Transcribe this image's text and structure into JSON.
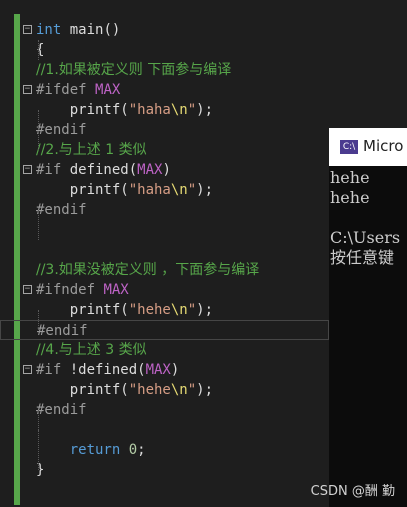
{
  "editor": {
    "lines": [
      {
        "fold": "−",
        "parts": [
          {
            "c": "kw",
            "t": "int"
          },
          {
            "c": "fn",
            "t": " main()"
          }
        ]
      },
      {
        "fold": "",
        "parts": [
          {
            "c": "fn",
            "t": "{"
          }
        ]
      },
      {
        "fold": "",
        "parts": [
          {
            "c": "cmt",
            "t": "//1.如果被定义则 下面参与编译"
          }
        ]
      },
      {
        "fold": "−",
        "parts": [
          {
            "c": "pp",
            "t": "#ifdef "
          },
          {
            "c": "mac",
            "t": "MAX"
          }
        ]
      },
      {
        "fold": "",
        "parts": [
          {
            "c": "fn",
            "t": "    printf("
          },
          {
            "c": "str",
            "t": "\"haha"
          },
          {
            "c": "esc",
            "t": "\\n"
          },
          {
            "c": "str",
            "t": "\""
          },
          {
            "c": "fn",
            "t": ");"
          }
        ]
      },
      {
        "fold": "",
        "parts": [
          {
            "c": "pp",
            "t": "#endif"
          }
        ]
      },
      {
        "fold": "",
        "parts": [
          {
            "c": "cmt",
            "t": "//2.与上述 1 类似"
          }
        ]
      },
      {
        "fold": "−",
        "parts": [
          {
            "c": "pp",
            "t": "#if "
          },
          {
            "c": "fn",
            "t": "defined("
          },
          {
            "c": "mac",
            "t": "MAX"
          },
          {
            "c": "fn",
            "t": ")"
          }
        ]
      },
      {
        "fold": "",
        "parts": [
          {
            "c": "fn",
            "t": "    printf("
          },
          {
            "c": "str",
            "t": "\"haha"
          },
          {
            "c": "esc",
            "t": "\\n"
          },
          {
            "c": "str",
            "t": "\""
          },
          {
            "c": "fn",
            "t": ");"
          }
        ]
      },
      {
        "fold": "",
        "parts": [
          {
            "c": "pp",
            "t": "#endif"
          }
        ]
      },
      {
        "fold": "",
        "parts": []
      },
      {
        "fold": "",
        "parts": []
      },
      {
        "fold": "",
        "parts": [
          {
            "c": "cmt",
            "t": "//3.如果没被定义则 ，下面参与编译"
          }
        ]
      },
      {
        "fold": "−",
        "parts": [
          {
            "c": "pp",
            "t": "#ifndef "
          },
          {
            "c": "mac",
            "t": "MAX"
          }
        ]
      },
      {
        "fold": "",
        "parts": [
          {
            "c": "fn",
            "t": "    printf("
          },
          {
            "c": "str",
            "t": "\"hehe"
          },
          {
            "c": "esc",
            "t": "\\n"
          },
          {
            "c": "str",
            "t": "\""
          },
          {
            "c": "fn",
            "t": ");"
          }
        ]
      },
      {
        "fold": "",
        "highlight": true,
        "parts": [
          {
            "c": "pp",
            "t": "#endif"
          }
        ]
      },
      {
        "fold": "",
        "parts": [
          {
            "c": "cmt",
            "t": "//4.与上述 3 类似"
          }
        ]
      },
      {
        "fold": "−",
        "parts": [
          {
            "c": "pp",
            "t": "#if "
          },
          {
            "c": "fn",
            "t": "!defined("
          },
          {
            "c": "mac",
            "t": "MAX"
          },
          {
            "c": "fn",
            "t": ")"
          }
        ]
      },
      {
        "fold": "",
        "parts": [
          {
            "c": "fn",
            "t": "    printf("
          },
          {
            "c": "str",
            "t": "\"hehe"
          },
          {
            "c": "esc",
            "t": "\\n"
          },
          {
            "c": "str",
            "t": "\""
          },
          {
            "c": "fn",
            "t": ");"
          }
        ]
      },
      {
        "fold": "",
        "parts": [
          {
            "c": "pp",
            "t": "#endif"
          }
        ]
      },
      {
        "fold": "",
        "parts": []
      },
      {
        "fold": "",
        "parts": [
          {
            "c": "fn",
            "t": "    "
          },
          {
            "c": "kw",
            "t": "return"
          },
          {
            "c": "fn",
            "t": " "
          },
          {
            "c": "num",
            "t": "0"
          },
          {
            "c": "fn",
            "t": ";"
          }
        ]
      },
      {
        "fold": "",
        "parts": [
          {
            "c": "fn",
            "t": "}"
          }
        ]
      }
    ]
  },
  "console": {
    "icon_text": "C:\\",
    "title": "Micro",
    "output_lines": [
      "hehe",
      "hehe",
      "",
      "C:\\Users",
      "按任意键"
    ]
  },
  "watermark": "CSDN @酬 勤",
  "colors": {
    "editor_bg": "#1e1e1e",
    "keyword": "#569cd6",
    "comment": "#57a64a",
    "string": "#d69d85",
    "macro": "#bd63c5",
    "preprocessor": "#9b9b9b",
    "console_bg": "#0c0c0c"
  }
}
